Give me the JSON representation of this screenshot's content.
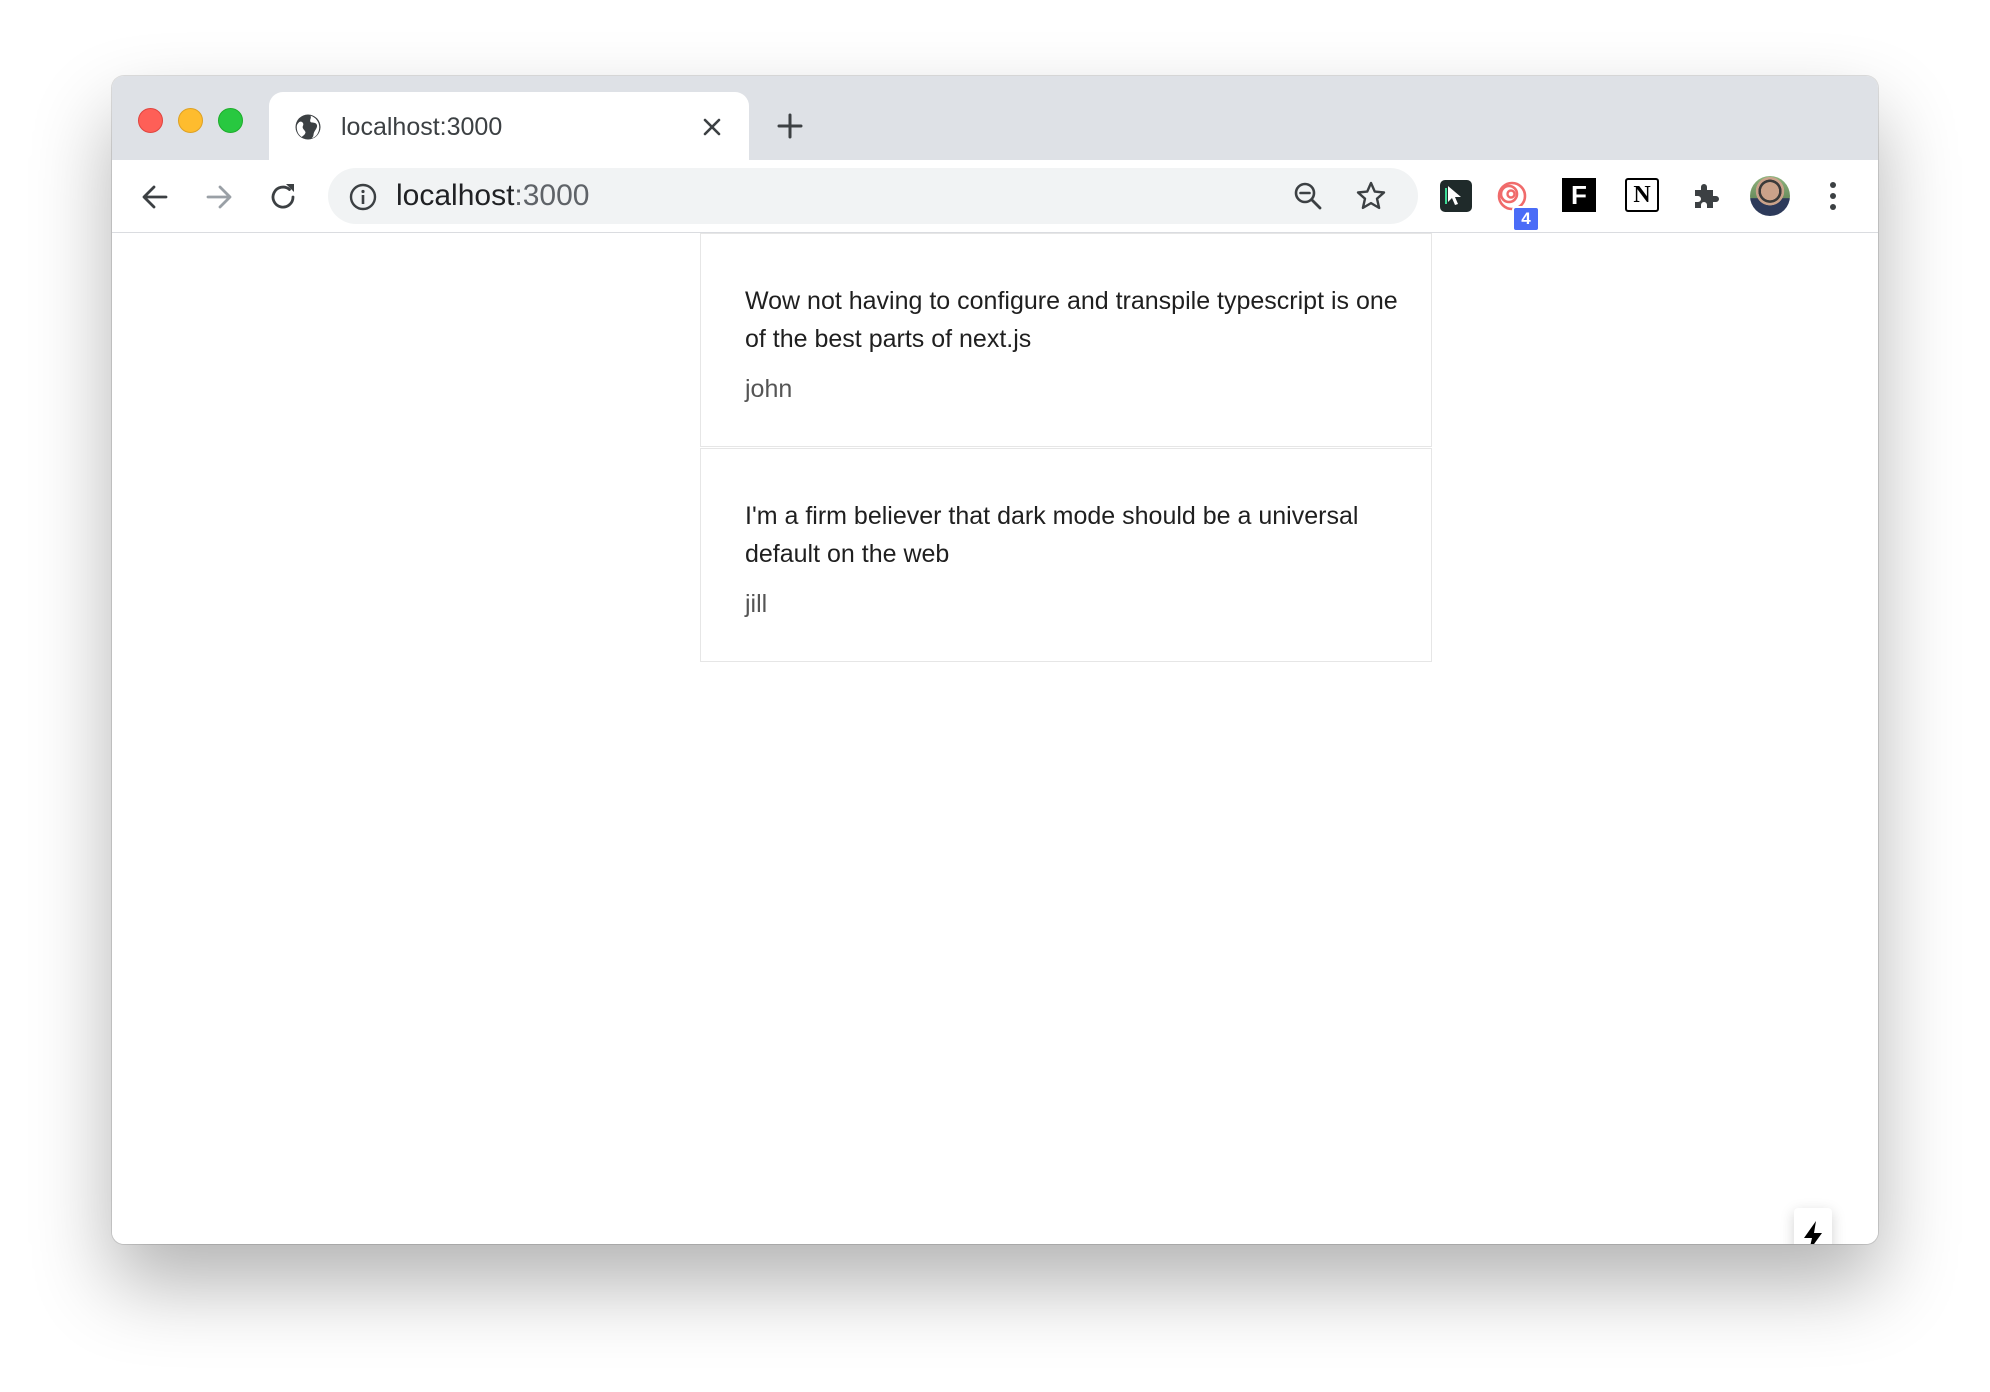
{
  "browser": {
    "tab": {
      "title": "localhost:3000",
      "favicon": "globe-icon"
    },
    "omnibox": {
      "host": "localhost",
      "port": ":3000"
    },
    "extensions": [
      {
        "name": "cursor-extension-icon"
      },
      {
        "name": "spiral-extension-icon",
        "badge": "4"
      },
      {
        "name": "f-extension-icon",
        "label": "F"
      },
      {
        "name": "notion-extension-icon",
        "label": "N"
      },
      {
        "name": "puzzle-extensions-icon"
      },
      {
        "name": "profile-avatar"
      }
    ],
    "colors": {
      "tabstrip": "#dee1e6",
      "close": "#fe5f57",
      "minimize": "#febc2e",
      "maximize": "#28c840",
      "badge": "#4a6cf7"
    }
  },
  "posts": [
    {
      "text": "Wow not having to configure and transpile typescript is one of the best parts of next.js",
      "author": "john"
    },
    {
      "text": "I'm a firm believer that dark mode should be a universal default on the web",
      "author": "jill"
    }
  ],
  "dev_indicator": {
    "icon": "lightning-bolt-icon"
  }
}
